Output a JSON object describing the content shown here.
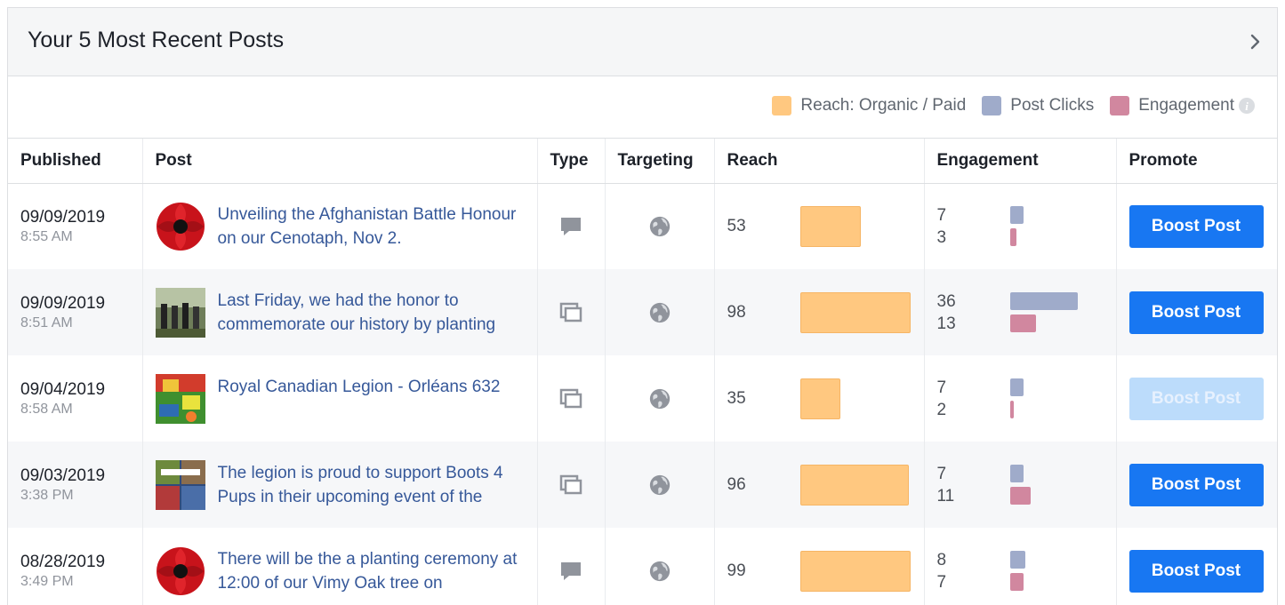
{
  "panel": {
    "title": "Your 5 Most Recent Posts",
    "chevron_icon": "chevron-right-icon"
  },
  "legend": {
    "items": [
      {
        "label": "Reach: Organic / Paid",
        "color": "#ffc880"
      },
      {
        "label": "Post Clicks",
        "color": "#9fabca"
      },
      {
        "label": "Engagement",
        "color": "#d1879f"
      }
    ],
    "info_icon": "info-icon"
  },
  "columns": {
    "published": "Published",
    "post": "Post",
    "type": "Type",
    "targeting": "Targeting",
    "reach": "Reach",
    "engagement": "Engagement",
    "promote": "Promote"
  },
  "posts": [
    {
      "date": "09/09/2019",
      "time": "8:55 AM",
      "thumbnail": "poppy",
      "text": "Unveiling the Afghanistan Battle Honour on our Cenotaph, Nov 2.",
      "type_icon": "status-comment-icon",
      "targeting_icon": "globe-icon",
      "reach": "53",
      "reach_fraction": 0.55,
      "post_clicks": "7",
      "engagement": "3",
      "clicks_fraction": 0.2,
      "engagement_fraction": 0.09,
      "boost_label": "Boost Post",
      "boost_enabled": true
    },
    {
      "date": "09/09/2019",
      "time": "8:51 AM",
      "thumbnail": "photo-group",
      "text": "Last Friday, we had the honor to commemorate our history by planting",
      "type_icon": "photo-album-icon",
      "targeting_icon": "globe-icon",
      "reach": "98",
      "reach_fraction": 1.0,
      "post_clicks": "36",
      "engagement": "13",
      "clicks_fraction": 1.0,
      "engagement_fraction": 0.38,
      "boost_label": "Boost Post",
      "boost_enabled": true
    },
    {
      "date": "09/04/2019",
      "time": "8:58 AM",
      "thumbnail": "photo-colorful",
      "text": "Royal Canadian Legion - Orléans 632",
      "type_icon": "photo-album-icon",
      "targeting_icon": "globe-icon",
      "reach": "35",
      "reach_fraction": 0.36,
      "post_clicks": "7",
      "engagement": "2",
      "clicks_fraction": 0.2,
      "engagement_fraction": 0.05,
      "boost_label": "Boost Post",
      "boost_enabled": false
    },
    {
      "date": "09/03/2019",
      "time": "3:38 PM",
      "thumbnail": "photo-event",
      "text": "The legion is proud to support Boots 4 Pups in their upcoming event of the",
      "type_icon": "photo-album-icon",
      "targeting_icon": "globe-icon",
      "reach": "96",
      "reach_fraction": 0.98,
      "post_clicks": "7",
      "engagement": "11",
      "clicks_fraction": 0.2,
      "engagement_fraction": 0.3,
      "boost_label": "Boost Post",
      "boost_enabled": true
    },
    {
      "date": "08/28/2019",
      "time": "3:49 PM",
      "thumbnail": "poppy",
      "text": "There will be the a planting ceremony at 12:00 of our Vimy Oak tree on",
      "type_icon": "status-comment-icon",
      "targeting_icon": "globe-icon",
      "reach": "99",
      "reach_fraction": 1.0,
      "post_clicks": "8",
      "engagement": "7",
      "clicks_fraction": 0.22,
      "engagement_fraction": 0.2,
      "boost_label": "Boost Post",
      "boost_enabled": true
    }
  ]
}
